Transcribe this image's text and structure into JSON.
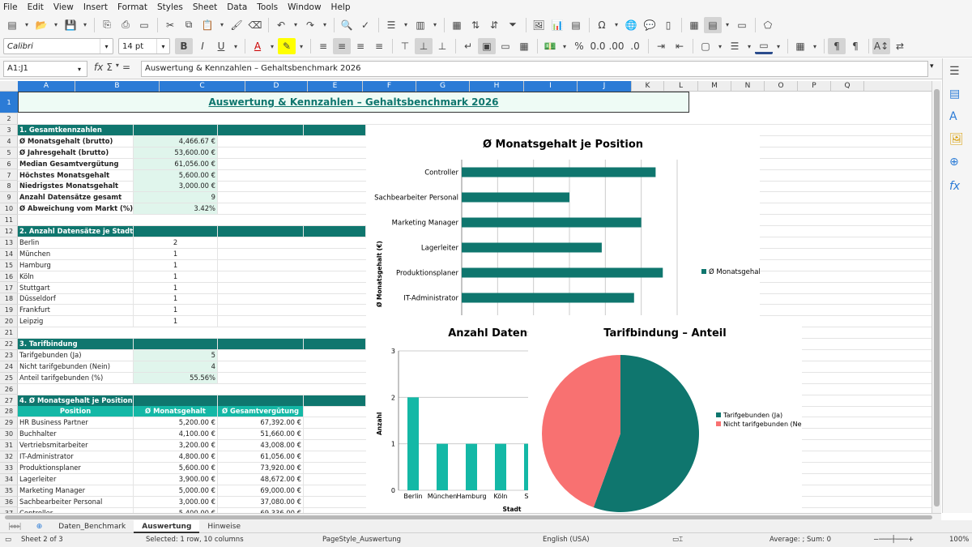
{
  "menu": [
    "File",
    "Edit",
    "View",
    "Insert",
    "Format",
    "Styles",
    "Sheet",
    "Data",
    "Tools",
    "Window",
    "Help"
  ],
  "font": {
    "name": "Calibri",
    "size": "14 pt"
  },
  "namebox": "A1:J1",
  "formula": "Auswertung & Kennzahlen – Gehaltsbenchmark 2026",
  "columns": [
    "A",
    "B",
    "C",
    "D",
    "E",
    "F",
    "G",
    "H",
    "I",
    "J",
    "K",
    "L",
    "M",
    "N",
    "O",
    "P",
    "Q"
  ],
  "title": "Auswertung & Kennzahlen – Gehaltsbenchmark 2026",
  "sections": {
    "s1": "1. Gesamtkennzahlen",
    "s2": "2. Anzahl Datensätze je Stadt",
    "s3": "3. Tarifbindung",
    "s4": "4. Ø Monatsgehalt je Position"
  },
  "kpis": [
    {
      "label": "Ø Monatsgehalt (brutto)",
      "value": "4,466.67 €"
    },
    {
      "label": "Ø Jahresgehalt (brutto)",
      "value": "53,600.00 €"
    },
    {
      "label": "Median Gesamtvergütung",
      "value": "61,056.00 €"
    },
    {
      "label": "Höchstes Monatsgehalt",
      "value": "5,600.00 €"
    },
    {
      "label": "Niedrigstes Monatsgehalt",
      "value": "3,000.00 €"
    },
    {
      "label": "Anzahl Datensätze gesamt",
      "value": "9"
    },
    {
      "label": "Ø Abweichung vom Markt (%)",
      "value": "3.42%"
    }
  ],
  "cities": [
    {
      "name": "Berlin",
      "count": "2"
    },
    {
      "name": "München",
      "count": "1"
    },
    {
      "name": "Hamburg",
      "count": "1"
    },
    {
      "name": "Köln",
      "count": "1"
    },
    {
      "name": "Stuttgart",
      "count": "1"
    },
    {
      "name": "Düsseldorf",
      "count": "1"
    },
    {
      "name": "Frankfurt",
      "count": "1"
    },
    {
      "name": "Leipzig",
      "count": "1"
    }
  ],
  "tarif": [
    {
      "label": "Tarifgebunden (Ja)",
      "value": "5"
    },
    {
      "label": "Nicht tarifgebunden (Nein)",
      "value": "4"
    },
    {
      "label": "Anteil tarifgebunden (%)",
      "value": "55.56%"
    }
  ],
  "posHeaders": [
    "Position",
    "Ø Monatsgehalt",
    "Ø Gesamtvergütung"
  ],
  "positions": [
    {
      "pos": "HR Business Partner",
      "m": "5,200.00 €",
      "g": "67,392.00 €"
    },
    {
      "pos": "Buchhalter",
      "m": "4,100.00 €",
      "g": "51,660.00 €"
    },
    {
      "pos": "Vertriebsmitarbeiter",
      "m": "3,200.00 €",
      "g": "43,008.00 €"
    },
    {
      "pos": "IT-Administrator",
      "m": "4,800.00 €",
      "g": "61,056.00 €"
    },
    {
      "pos": "Produktionsplaner",
      "m": "5,600.00 €",
      "g": "73,920.00 €"
    },
    {
      "pos": "Lagerleiter",
      "m": "3,900.00 €",
      "g": "48,672.00 €"
    },
    {
      "pos": "Marketing Manager",
      "m": "5,000.00 €",
      "g": "69,000.00 €"
    },
    {
      "pos": "Sachbearbeiter Personal",
      "m": "3,000.00 €",
      "g": "37,080.00 €"
    },
    {
      "pos": "Controller",
      "m": "5,400.00 €",
      "g": "69,336.00 €"
    }
  ],
  "chart_data": [
    {
      "type": "bar",
      "orientation": "horizontal",
      "title": "Ø Monatsgehalt je Position",
      "ylabel": "Ø Monatsgehalt (€)",
      "categories": [
        "Controller",
        "Sachbearbeiter Personal",
        "Marketing Manager",
        "Lagerleiter",
        "Produktionsplaner",
        "IT-Administrator"
      ],
      "series": [
        {
          "name": "Ø Monatsgehalt",
          "values": [
            5400,
            3000,
            5000,
            3900,
            5600,
            4800
          ]
        }
      ],
      "color": "#0f766e",
      "legend": "right"
    },
    {
      "type": "bar",
      "title": "Anzahl Datens",
      "xlabel": "Stadt",
      "ylabel": "Anzahl",
      "categories": [
        "Berlin",
        "München",
        "Hamburg",
        "Köln",
        "Stu"
      ],
      "values": [
        2,
        1,
        1,
        1,
        1
      ],
      "ylim": [
        0,
        3
      ],
      "ticks": [
        "0",
        "1",
        "2",
        "3"
      ],
      "color": "#14b8a6"
    },
    {
      "type": "pie",
      "title": "Tarifbindung – Anteil",
      "categories": [
        "Tarifgebunden (Ja)",
        "Nicht tarifgebunden (Nein)"
      ],
      "values": [
        5,
        4
      ],
      "colors": [
        "#0f766e",
        "#f87171"
      ],
      "legend": "right"
    }
  ],
  "sheets": [
    "Daten_Benchmark",
    "Auswertung",
    "Hinweise"
  ],
  "status": {
    "sheet": "Sheet 2 of 3",
    "selected": "Selected: 1 row, 10 columns",
    "style": "PageStyle_Auswertung",
    "lang": "English (USA)",
    "sum": "Average: ; Sum: 0",
    "zoom": "100%"
  }
}
